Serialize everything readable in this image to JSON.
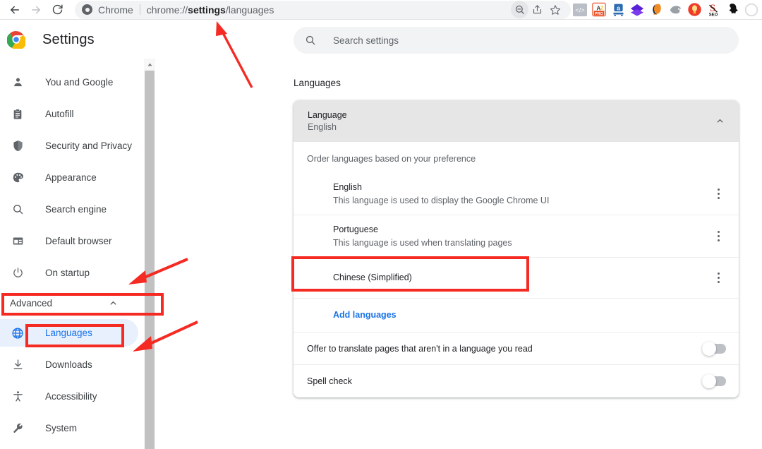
{
  "browser": {
    "back_icon": "back-arrow-icon",
    "forward_icon": "forward-arrow-icon",
    "reload_icon": "reload-icon",
    "omnibox": {
      "app_label": "Chrome",
      "url_prefix": "chrome://",
      "url_bold": "settings",
      "url_suffix": "/languages",
      "full_url": "chrome://settings/languages"
    },
    "actions": [
      {
        "name": "zoom-out-icon",
        "label": "Zoom"
      },
      {
        "name": "share-icon",
        "label": "Share"
      },
      {
        "name": "bookmark-star-icon",
        "label": "Bookmark"
      }
    ],
    "extensions": [
      {
        "name": "code-brackets-extension-icon",
        "label": "</>"
      },
      {
        "name": "grammar-pro-extension-icon",
        "label": "AZ PRO"
      },
      {
        "name": "amazon-extension-icon",
        "label": "a"
      },
      {
        "name": "purple-diamond-extension-icon",
        "label": ""
      },
      {
        "name": "orange-swirl-extension-icon",
        "label": ""
      },
      {
        "name": "gray-badge-extension-icon",
        "label": ""
      },
      {
        "name": "orange-bulb-extension-icon",
        "label": ""
      },
      {
        "name": "seo-extension-icon",
        "label": "SEO"
      },
      {
        "name": "snapchat-ghost-extension-icon",
        "label": ""
      },
      {
        "name": "partial-extension-icon",
        "label": ""
      }
    ]
  },
  "sidebar": {
    "brand_title": "Settings",
    "brand_logo": "chrome-logo-icon",
    "items": [
      {
        "label": "You and Google",
        "icon": "person-icon"
      },
      {
        "label": "Autofill",
        "icon": "clipboard-icon"
      },
      {
        "label": "Security and Privacy",
        "icon": "shield-icon"
      },
      {
        "label": "Appearance",
        "icon": "palette-icon"
      },
      {
        "label": "Search engine",
        "icon": "magnifier-icon"
      },
      {
        "label": "Default browser",
        "icon": "window-icon"
      },
      {
        "label": "On startup",
        "icon": "power-icon"
      }
    ],
    "advanced": {
      "label": "Advanced",
      "chevron": "chevron-up-icon",
      "expanded": true
    },
    "advanced_items": [
      {
        "label": "Languages",
        "icon": "globe-icon",
        "active": true
      },
      {
        "label": "Downloads",
        "icon": "download-icon",
        "active": false
      },
      {
        "label": "Accessibility",
        "icon": "accessibility-icon",
        "active": false
      },
      {
        "label": "System",
        "icon": "wrench-icon",
        "active": false
      }
    ]
  },
  "main": {
    "search": {
      "placeholder": "Search settings",
      "icon": "search-icon"
    },
    "section_title": "Languages",
    "card": {
      "header": {
        "title": "Language",
        "subtitle": "English",
        "chevron": "chevron-up-icon"
      },
      "order_label": "Order languages based on your preference",
      "languages": [
        {
          "name": "English",
          "description": "This language is used to display the Google Chrome UI",
          "menu_icon": "more-vertical-icon",
          "highlighted": false
        },
        {
          "name": "Portuguese",
          "description": "This language is used when translating pages",
          "menu_icon": "more-vertical-icon",
          "highlighted": false
        },
        {
          "name": "Chinese (Simplified)",
          "description": "",
          "menu_icon": "more-vertical-icon",
          "highlighted": true
        }
      ],
      "add_languages_label": "Add languages",
      "toggles": [
        {
          "label": "Offer to translate pages that aren't in a language you read",
          "on": false
        },
        {
          "label": "Spell check",
          "on": false
        }
      ]
    }
  },
  "annotations": {
    "highlight_color": "#f52a22",
    "boxes": [
      {
        "name": "advanced-highlight-box",
        "target": "Advanced"
      },
      {
        "name": "languages-highlight-box",
        "target": "Languages"
      },
      {
        "name": "chinese-highlight-box",
        "target": "Chinese (Simplified)"
      }
    ],
    "arrows": [
      {
        "name": "arrow-to-url-bar",
        "points_to": "chrome://settings/languages"
      },
      {
        "name": "arrow-to-advanced",
        "points_to": "Advanced"
      },
      {
        "name": "arrow-to-languages",
        "points_to": "Languages"
      }
    ]
  }
}
